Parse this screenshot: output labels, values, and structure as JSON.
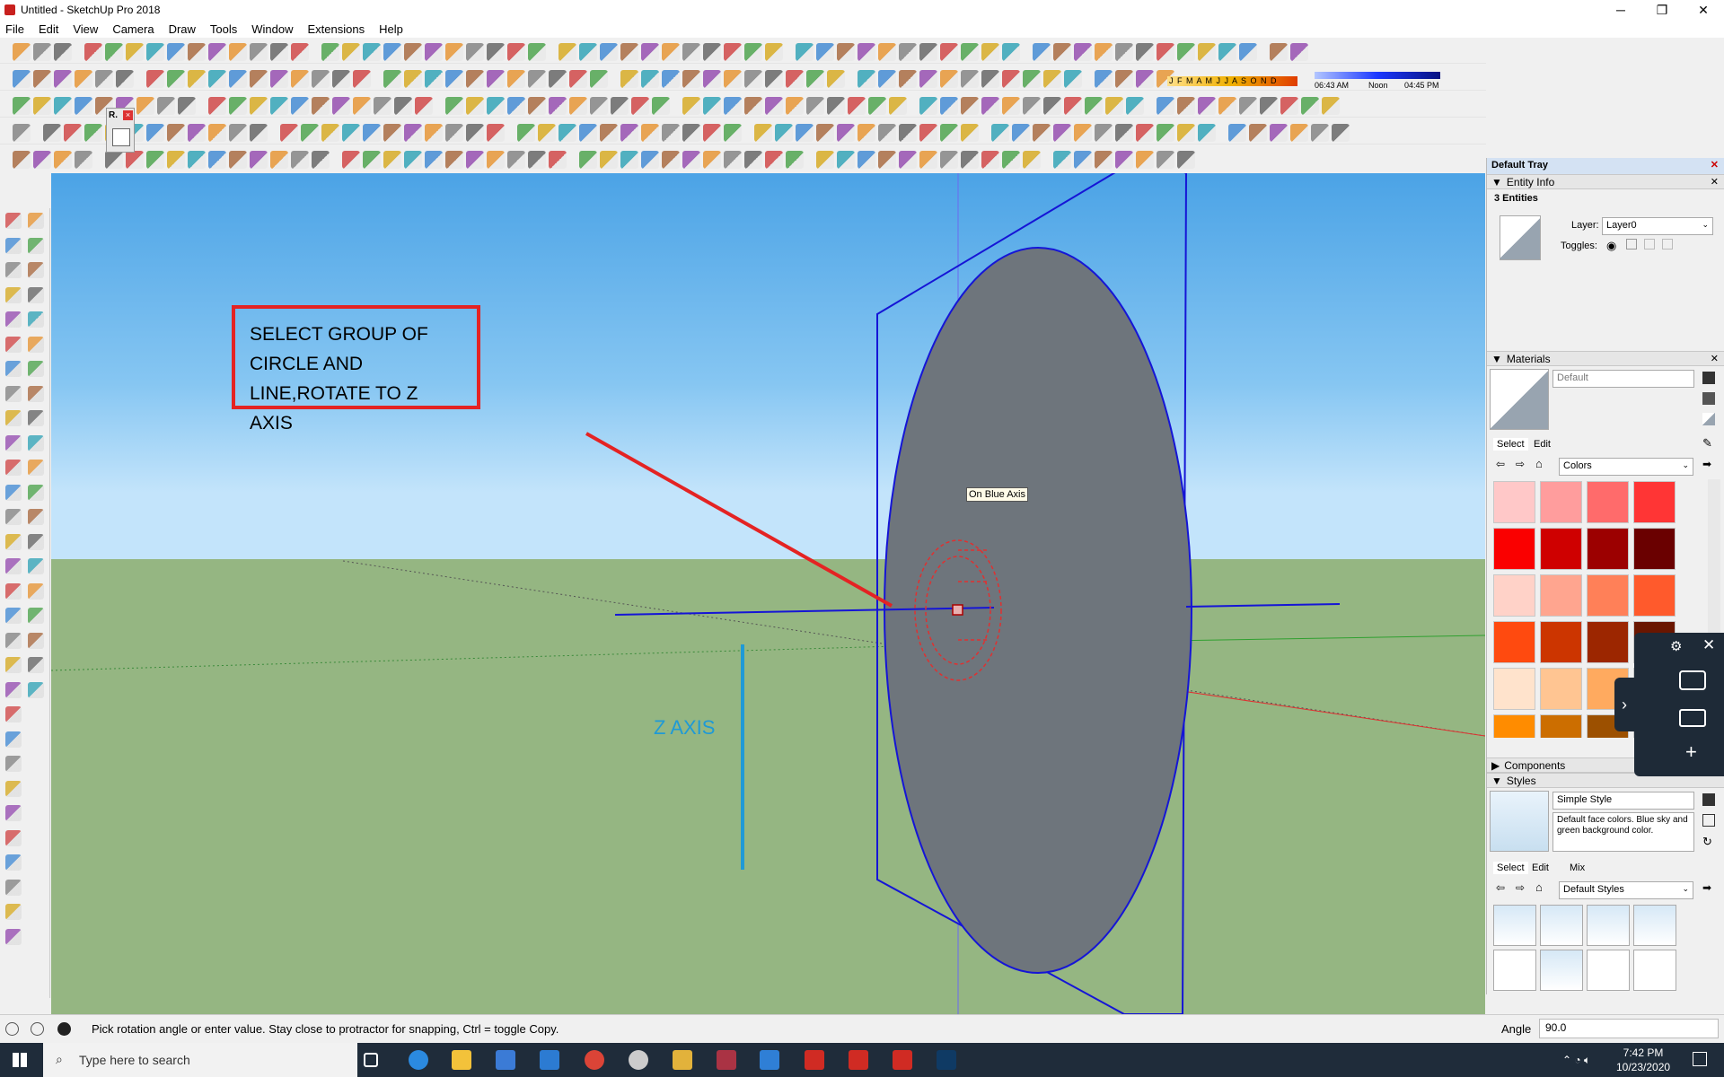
{
  "window": {
    "title": "Untitled - SketchUp Pro 2018",
    "minimize": "─",
    "maximize": "❐",
    "close": "✕"
  },
  "menu": [
    "File",
    "Edit",
    "View",
    "Camera",
    "Draw",
    "Tools",
    "Window",
    "Extensions",
    "Help"
  ],
  "shadow_bar": {
    "months": "J F M A M J J A S O N D",
    "time_start": "06:43 AM",
    "time_mid": "Noon",
    "time_end": "04:45 PM"
  },
  "small_panel": {
    "label": "R."
  },
  "viewport": {
    "callout_text": "SELECT GROUP OF CIRCLE AND LINE,ROTATE TO Z AXIS",
    "z_axis_label": "Z AXIS",
    "tooltip": "On Blue Axis"
  },
  "tray": {
    "title": "Default Tray",
    "entity_info": {
      "header": "Entity Info",
      "count": "3 Entities",
      "layer_label": "Layer:",
      "layer_value": "Layer0",
      "toggles_label": "Toggles:"
    },
    "materials": {
      "header": "Materials",
      "name": "Default",
      "tab_select": "Select",
      "tab_edit": "Edit",
      "library": "Colors",
      "swatches": [
        "#ffc8c8",
        "#ff9d9d",
        "#ff6b6b",
        "#ff3535",
        "#fa0000",
        "#cf0000",
        "#9c0000",
        "#6a0000",
        "#ffd2c8",
        "#ffa58f",
        "#ff8058",
        "#ff5a2c",
        "#ff4a0f",
        "#cc3500",
        "#9c2600",
        "#6a1600",
        "#ffe3cc",
        "#ffc592",
        "#ffaa5f",
        "#ff9230",
        "#ff8c00",
        "#cc6e00",
        "#9c5000",
        "#6a3400"
      ]
    },
    "components": {
      "header": "Components"
    },
    "styles": {
      "header": "Styles",
      "name": "Simple Style",
      "description": "Default face colors. Blue sky and green background color.",
      "tab_select": "Select",
      "tab_edit": "Edit",
      "tab_mix": "Mix",
      "library": "Default Styles"
    }
  },
  "statusbar": {
    "message": "Pick rotation angle or enter value.  Stay close to protractor for snapping, Ctrl = toggle Copy.",
    "angle_label": "Angle",
    "angle_value": "90.0"
  },
  "taskbar": {
    "search_placeholder": "Type here to search",
    "time": "7:42 PM",
    "date": "10/23/2020"
  },
  "colors": {
    "sky_top": "#4ba3e6",
    "ground": "#95b682",
    "callout_border": "#e42323",
    "axis_blue": "#1f9ad6",
    "circle_face": "#6e757c",
    "edge_blue": "#1515d6"
  }
}
